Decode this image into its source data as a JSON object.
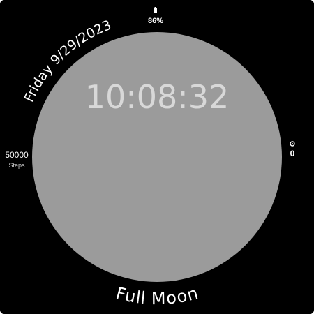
{
  "watch": {
    "time": "10:08:32",
    "date": "Friday 9/29/2023",
    "moon_phase": "Full Moon",
    "battery": "86%",
    "battery_icon": "battery-icon",
    "steps": {
      "value": "50000",
      "label": "Steps"
    },
    "right_complication": {
      "icon": "heart-rate-icon",
      "value": "0"
    },
    "colors": {
      "background": "#000000",
      "moon": "#9b9b9b",
      "time_text": "#d8d8d8",
      "text": "#ffffff"
    }
  }
}
